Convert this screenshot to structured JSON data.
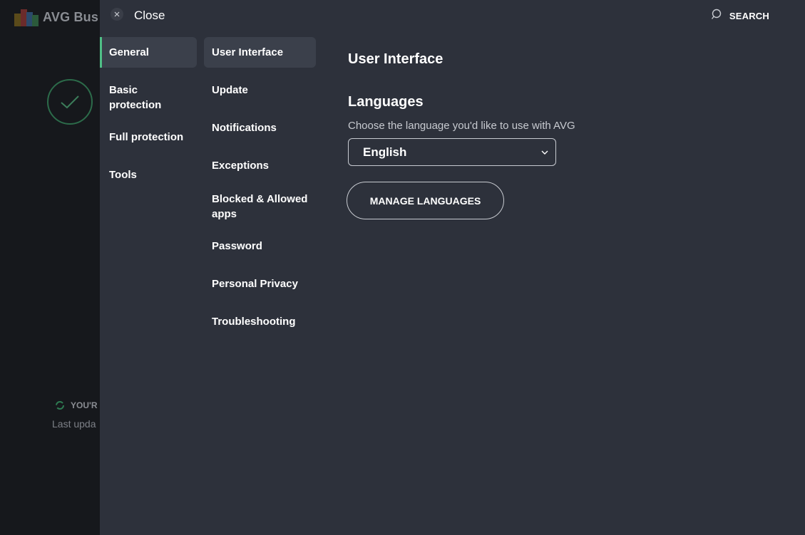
{
  "background_app": {
    "logo_text": "AVG Bus",
    "logo_icon": "avg-logo-icon",
    "status_text": "YOU'R",
    "last_update_text": "Last upda"
  },
  "topbar": {
    "close_label": "Close",
    "close_icon": "close-icon",
    "search_label": "SEARCH",
    "search_icon": "search-icon"
  },
  "categories": [
    {
      "label": "General",
      "active": true
    },
    {
      "label": "Basic protection",
      "active": false
    },
    {
      "label": "Full protection",
      "active": false
    },
    {
      "label": "Tools",
      "active": false
    }
  ],
  "subcategories": [
    {
      "label": "User Interface",
      "active": true
    },
    {
      "label": "Update",
      "active": false
    },
    {
      "label": "Notifications",
      "active": false
    },
    {
      "label": "Exceptions",
      "active": false
    },
    {
      "label": "Blocked & Allowed apps",
      "active": false
    },
    {
      "label": "Password",
      "active": false
    },
    {
      "label": "Personal Privacy",
      "active": false
    },
    {
      "label": "Troubleshooting",
      "active": false
    }
  ],
  "content": {
    "title": "User Interface",
    "section_title": "Languages",
    "description": "Choose the language you'd like to use with AVG",
    "language_value": "English",
    "manage_button": "MANAGE LANGUAGES"
  },
  "colors": {
    "panel_bg": "#2d313b",
    "active_item_bg": "#3b404b",
    "accent_green": "#4fbf86"
  }
}
